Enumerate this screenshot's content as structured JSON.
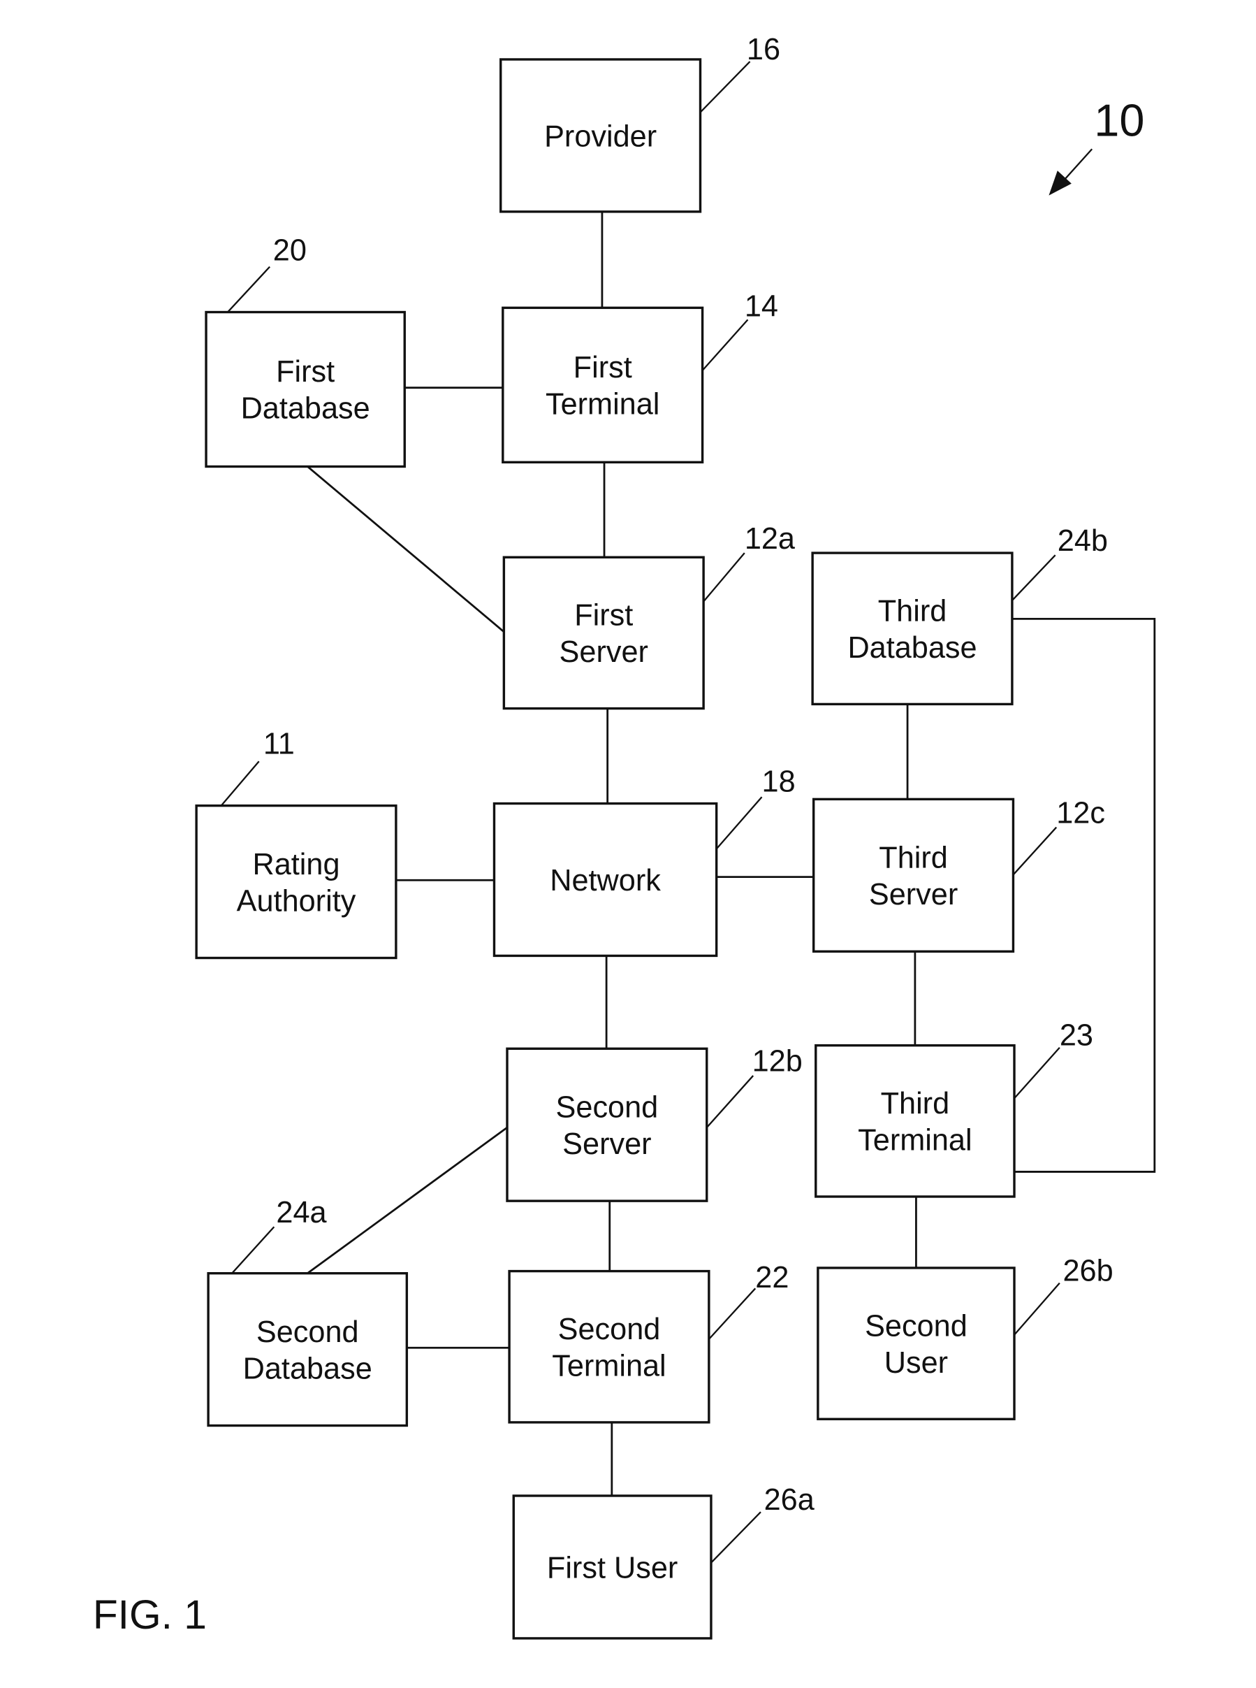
{
  "figure": {
    "caption": "FIG. 1",
    "system_ref": "10"
  },
  "nodes": [
    {
      "id": "provider",
      "lines": [
        "Provider"
      ],
      "ref": "16"
    },
    {
      "id": "first-database",
      "lines": [
        "First",
        "Database"
      ],
      "ref": "20"
    },
    {
      "id": "first-terminal",
      "lines": [
        "First",
        "Terminal"
      ],
      "ref": "14"
    },
    {
      "id": "first-server",
      "lines": [
        "First",
        "Server"
      ],
      "ref": "12a"
    },
    {
      "id": "third-database",
      "lines": [
        "Third",
        "Database"
      ],
      "ref": "24b"
    },
    {
      "id": "rating-authority",
      "lines": [
        "Rating",
        "Authority"
      ],
      "ref": "11"
    },
    {
      "id": "network",
      "lines": [
        "Network"
      ],
      "ref": "18"
    },
    {
      "id": "third-server",
      "lines": [
        "Third",
        "Server"
      ],
      "ref": "12c"
    },
    {
      "id": "second-server",
      "lines": [
        "Second",
        "Server"
      ],
      "ref": "12b"
    },
    {
      "id": "third-terminal",
      "lines": [
        "Third",
        "Terminal"
      ],
      "ref": "23"
    },
    {
      "id": "second-database",
      "lines": [
        "Second",
        "Database"
      ],
      "ref": "24a"
    },
    {
      "id": "second-terminal",
      "lines": [
        "Second",
        "Terminal"
      ],
      "ref": "22"
    },
    {
      "id": "second-user",
      "lines": [
        "Second",
        "User"
      ],
      "ref": "26b"
    },
    {
      "id": "first-user",
      "lines": [
        "First User"
      ],
      "ref": "26a"
    }
  ],
  "edges": [
    [
      "provider",
      "first-terminal"
    ],
    [
      "first-database",
      "first-terminal"
    ],
    [
      "first-database",
      "first-server"
    ],
    [
      "first-terminal",
      "first-server"
    ],
    [
      "first-server",
      "network"
    ],
    [
      "rating-authority",
      "network"
    ],
    [
      "network",
      "third-server"
    ],
    [
      "third-database",
      "third-server"
    ],
    [
      "third-database",
      "third-terminal"
    ],
    [
      "third-server",
      "third-terminal"
    ],
    [
      "network",
      "second-server"
    ],
    [
      "second-server",
      "second-database"
    ],
    [
      "second-server",
      "second-terminal"
    ],
    [
      "second-database",
      "second-terminal"
    ],
    [
      "second-terminal",
      "first-user"
    ],
    [
      "third-terminal",
      "second-user"
    ]
  ]
}
